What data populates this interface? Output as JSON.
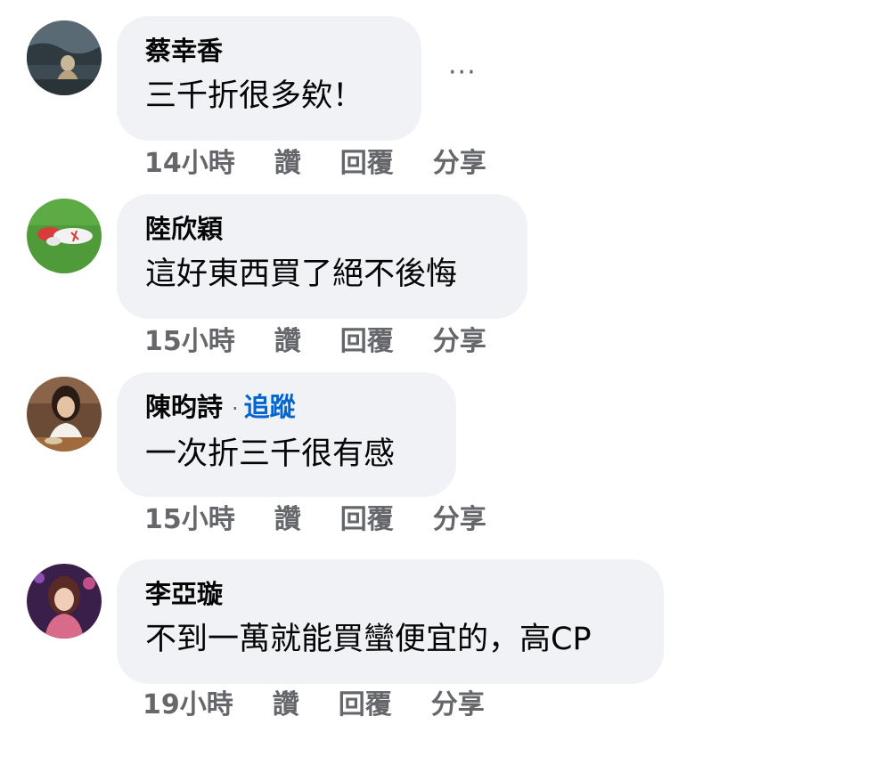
{
  "comments": [
    {
      "name": "蔡幸香",
      "text": "三千折很多欸！",
      "time": "14小時",
      "like": "讚",
      "reply": "回覆",
      "share": "分享",
      "more": "···"
    },
    {
      "name": "陸欣穎",
      "text": "這好東西買了絕不後悔",
      "time": "15小時",
      "like": "讚",
      "reply": "回覆",
      "share": "分享"
    },
    {
      "name": "陳昀詩",
      "separator": "·",
      "follow": "追蹤",
      "text": "一次折三千很有感",
      "time": "15小時",
      "like": "讚",
      "reply": "回覆",
      "share": "分享"
    },
    {
      "name": "李亞璇",
      "text": "不到一萬就能買蠻便宜的，高CP",
      "time": "19小時",
      "like": "讚",
      "reply": "回覆",
      "share": "分享"
    }
  ],
  "colors": {
    "bubble": "#f0f2f5",
    "name": "#050505",
    "meta": "#65676b",
    "follow": "#0064d1"
  }
}
